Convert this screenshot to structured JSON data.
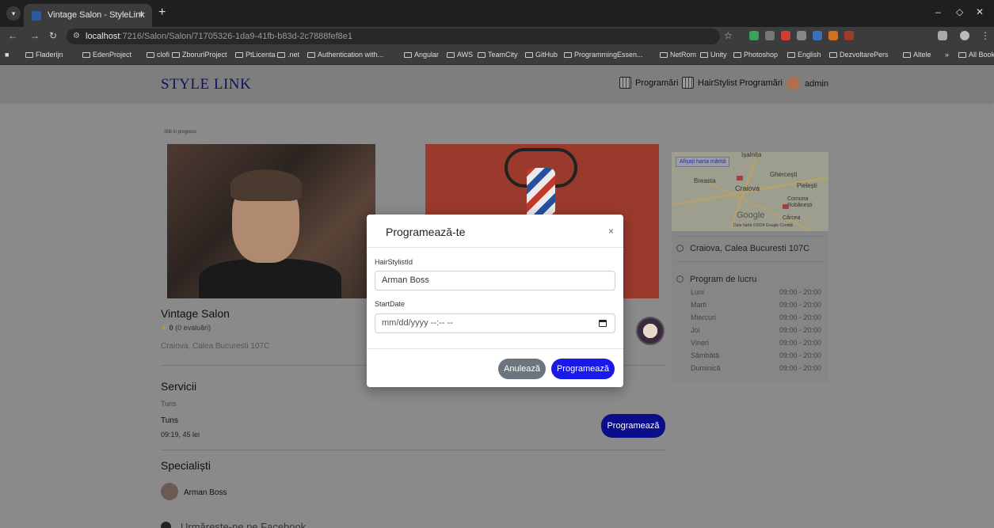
{
  "browser": {
    "tab_title": "Vintage Salon - StyleLink",
    "url_host": "localhost",
    "url_rest": ":7216/Salon/Salon/71705326-1da9-41fb-b83d-2c7888fef8e1",
    "bookmarks": [
      "Fladerijn",
      "EdenProject",
      "clofi",
      "ZboruriProject",
      "PtLicenta",
      ".net",
      "Authentication with...",
      "Angular",
      "AWS",
      "TeamCity",
      "GitHub",
      "ProgrammingEssen...",
      "NetRom",
      "Unity",
      "Photoshop",
      "English",
      "DezvoltarePers",
      "Altele"
    ],
    "more_bookmarks": "»",
    "all_bookmarks": "All Bookmarks"
  },
  "header": {
    "brand": "STYLE LINK",
    "nav_programari": "Programări",
    "nav_hairstylist": "HairStylist Programări",
    "user": "admin"
  },
  "salon": {
    "progress_note": "Still in progress",
    "name": "Vintage Salon",
    "star": "★",
    "rating_value": "0",
    "rating_count": "(0 evaluări)",
    "address": "Craiova, Calea Bucuresti 107C"
  },
  "services": {
    "title": "Servicii",
    "category": "Tuns",
    "name": "Tuns",
    "meta": "09:19, 45 lei",
    "book_label": "Programează"
  },
  "specialists": {
    "title": "Specialiști",
    "name": "Arman Boss"
  },
  "facebook": "Urmărește-ne pe Facebook",
  "map": {
    "big_map": "Afișați harta mărită",
    "cities": [
      "Işalnița",
      "Breasta",
      "Craiova",
      "Ghercești",
      "Pielești",
      "Comuna Robănești",
      "Cârcea"
    ],
    "google": "Google",
    "attribution": "Date hartă ©2024 Google   Condiții"
  },
  "sidebar": {
    "address": "Craiova, Calea Bucuresti 107C",
    "hours_title": "Program de lucru",
    "hours": [
      {
        "day": "Luni",
        "time": "09:00 - 20:00"
      },
      {
        "day": "Marti",
        "time": "09:00 - 20:00"
      },
      {
        "day": "Miercuri",
        "time": "09:00 - 20:00"
      },
      {
        "day": "Joi",
        "time": "09:00 - 20:00"
      },
      {
        "day": "Vineri",
        "time": "09:00 - 20:00"
      },
      {
        "day": "Sâmbătă",
        "time": "09:00 - 20:00"
      },
      {
        "day": "Duminică",
        "time": "09:00 - 20:00"
      }
    ]
  },
  "modal": {
    "title": "Programează-te",
    "close": "×",
    "field1_label": "HairStylistId",
    "field1_value": "Arman Boss",
    "field2_label": "StartDate",
    "field2_placeholder": "mm/dd/yyyy --:-- --",
    "cancel_label": "Anulează",
    "submit_label": "Programează"
  }
}
